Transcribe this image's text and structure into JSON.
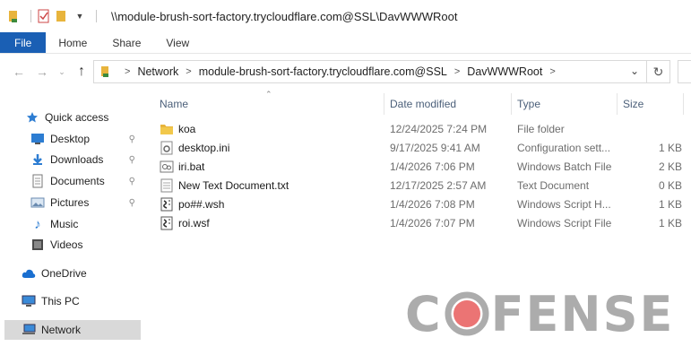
{
  "window": {
    "title": "\\\\module-brush-sort-factory.trycloudflare.com@SSL\\DavWWWRoot"
  },
  "ribbon": {
    "tabs": [
      "File",
      "Home",
      "Share",
      "View"
    ]
  },
  "address": {
    "crumbs": [
      "Network",
      "module-brush-sort-factory.trycloudflare.com@SSL",
      "DavWWWRoot"
    ]
  },
  "navpane": {
    "items": [
      {
        "label": "Quick access",
        "icon": "star-icon",
        "pinned": false
      },
      {
        "label": "Desktop",
        "icon": "desktop-icon",
        "pinned": true
      },
      {
        "label": "Downloads",
        "icon": "download-icon",
        "pinned": true
      },
      {
        "label": "Documents",
        "icon": "documents-icon",
        "pinned": true
      },
      {
        "label": "Pictures",
        "icon": "pictures-icon",
        "pinned": true
      },
      {
        "label": "Music",
        "icon": "music-icon",
        "pinned": false
      },
      {
        "label": "Videos",
        "icon": "videos-icon",
        "pinned": false
      },
      {
        "label": "OneDrive",
        "icon": "cloud-icon",
        "pinned": false
      },
      {
        "label": "This PC",
        "icon": "computer-icon",
        "pinned": false
      },
      {
        "label": "Network",
        "icon": "network-icon",
        "pinned": false
      }
    ]
  },
  "filelist": {
    "columns": {
      "name": "Name",
      "date": "Date modified",
      "type": "Type",
      "size": "Size"
    },
    "rows": [
      {
        "name": "koa",
        "date": "12/24/2025 7:24 PM",
        "type": "File folder",
        "size": "",
        "icon": "folder-icon"
      },
      {
        "name": "desktop.ini",
        "date": "9/17/2025 9:41 AM",
        "type": "Configuration sett...",
        "size": "1 KB",
        "icon": "settings-file-icon"
      },
      {
        "name": "iri.bat",
        "date": "1/4/2026 7:06 PM",
        "type": "Windows Batch File",
        "size": "2 KB",
        "icon": "batch-file-icon"
      },
      {
        "name": "New Text Document.txt",
        "date": "12/17/2025 2:57 AM",
        "type": "Text Document",
        "size": "0 KB",
        "icon": "text-file-icon"
      },
      {
        "name": "po##.wsh",
        "date": "1/4/2026 7:08 PM",
        "type": "Windows Script H...",
        "size": "1 KB",
        "icon": "script-file-icon"
      },
      {
        "name": "roi.wsf",
        "date": "1/4/2026 7:07 PM",
        "type": "Windows Script File",
        "size": "1 KB",
        "icon": "script-file-icon"
      }
    ]
  },
  "watermark": {
    "left": "C",
    "right": "FENSE"
  },
  "colors": {
    "file_tab": "#1a5fb4",
    "folder": "#e8b43c",
    "watermark_o": "#e85c5c",
    "header_text": "#4c607a"
  }
}
